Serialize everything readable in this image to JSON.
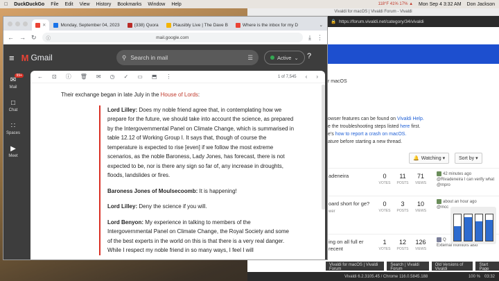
{
  "menubar": {
    "app": "DuckDuckGo",
    "items": [
      "File",
      "Edit",
      "View",
      "History",
      "Bookmarks",
      "Window",
      "Help"
    ],
    "status": "118°F  41%  17% ▲",
    "datetime": "Mon Sep 4  3:32 AM",
    "user": "Don Jackson"
  },
  "vivaldi": {
    "window_title": "Vivaldi for macOS | Vivaldi Forum - Vivaldi",
    "url": "https://forum.vivaldi.net/category/34/vivaldi",
    "lines": [
      {
        "text": "r macOS"
      },
      {
        "text": "owser features can be found on ",
        "link": "Vivaldi Help."
      },
      {
        "text": "e the troubleshooting steps listed ",
        "link": "here",
        "after": " first."
      },
      {
        "text": "e's ",
        "link": "how to report a crash on macOS."
      },
      {
        "text": "ature before starting a new thread."
      }
    ],
    "watching_label": "Watching ▾",
    "sort_label": "Sort by ▾",
    "rows": [
      {
        "topic": "adeneira",
        "votes": "0",
        "posts": "11",
        "views": "71",
        "recent": "42 minutes ago",
        "recent2": "@Rivadeneira I can verify what @mpro"
      },
      {
        "topic": "oard short for ge?",
        "topic2": "wer",
        "votes": "0",
        "posts": "3",
        "views": "10",
        "recent": "about an hour ago",
        "recent2": "@mcc"
      },
      {
        "topic": "ing on all full er recent",
        "votes": "1",
        "posts": "12",
        "views": "126",
        "recent": "Q",
        "recent2": "External monitors also"
      }
    ],
    "stat_labels": {
      "votes": "VOTES",
      "posts": "POSTS",
      "views": "VIEWS"
    },
    "statusbar": "Vivaldi 6.2.3105.45 / Chrome 116.0.5845.188",
    "tabs": [
      "Vivaldi for macOS | Vivaldi Forum",
      "Search | Vivaldi Forum",
      "Old Versions of Vivaldi",
      "Start Page"
    ],
    "zoom": "100 %",
    "clock": "03:32"
  },
  "widget": {
    "levels": [
      0.55,
      0.9,
      0.75,
      0.8
    ]
  },
  "chrome": {
    "tabs": [
      {
        "label": "Monday, September 04, 2023",
        "color": "#1a73e8"
      },
      {
        "label": "(338) Quora",
        "color": "#b92b27"
      },
      {
        "label": "Plausibly Live | The Dave B",
        "color": "#f4b400"
      },
      {
        "label": "Where is the inbox for my D",
        "color": "#ea4335"
      }
    ],
    "url": "mail.google.com"
  },
  "gmail": {
    "logo_text": "Gmail",
    "search_placeholder": "Search in mail",
    "status": "Active",
    "rail": [
      {
        "label": "Mail",
        "badge": "99+"
      },
      {
        "label": "Chat"
      },
      {
        "label": "Spaces"
      },
      {
        "label": "Meet"
      }
    ],
    "count": "1 of 7,545",
    "intro_text": "Their exchange began in late July in the ",
    "intro_link": "House of Lords",
    "intro_end": ":",
    "paragraphs": [
      {
        "speaker": "Lord Lilley:",
        "text": " Does my noble friend agree that, in contemplating how we prepare for the future, we should take into account the science, as prepared by the Intergovernmental Panel on Climate Change, which is summarised in table 12.12 of Working Group I. It says that, though of course the temperature is expected to rise [even] if we follow the most extreme scenarios, as the noble Baroness, Lady Jones, has forecast, there is not expected to be, nor is there any sign so far of, any increase in droughts, floods, landslides or fires."
      },
      {
        "speaker": "Baroness Jones of Moulsecoomb:",
        "text": " It is happening!"
      },
      {
        "speaker": "Lord Lilley:",
        "text": " Deny the science if you will."
      },
      {
        "speaker": "Lord Benyon:",
        "text": " My experience in talking to members of the Intergovernmental Panel on Climate Change, the Royal Society and some of the best experts in the world on this is that there is a very real danger. While I respect my noble friend in so many ways, I feel I will"
      }
    ]
  }
}
